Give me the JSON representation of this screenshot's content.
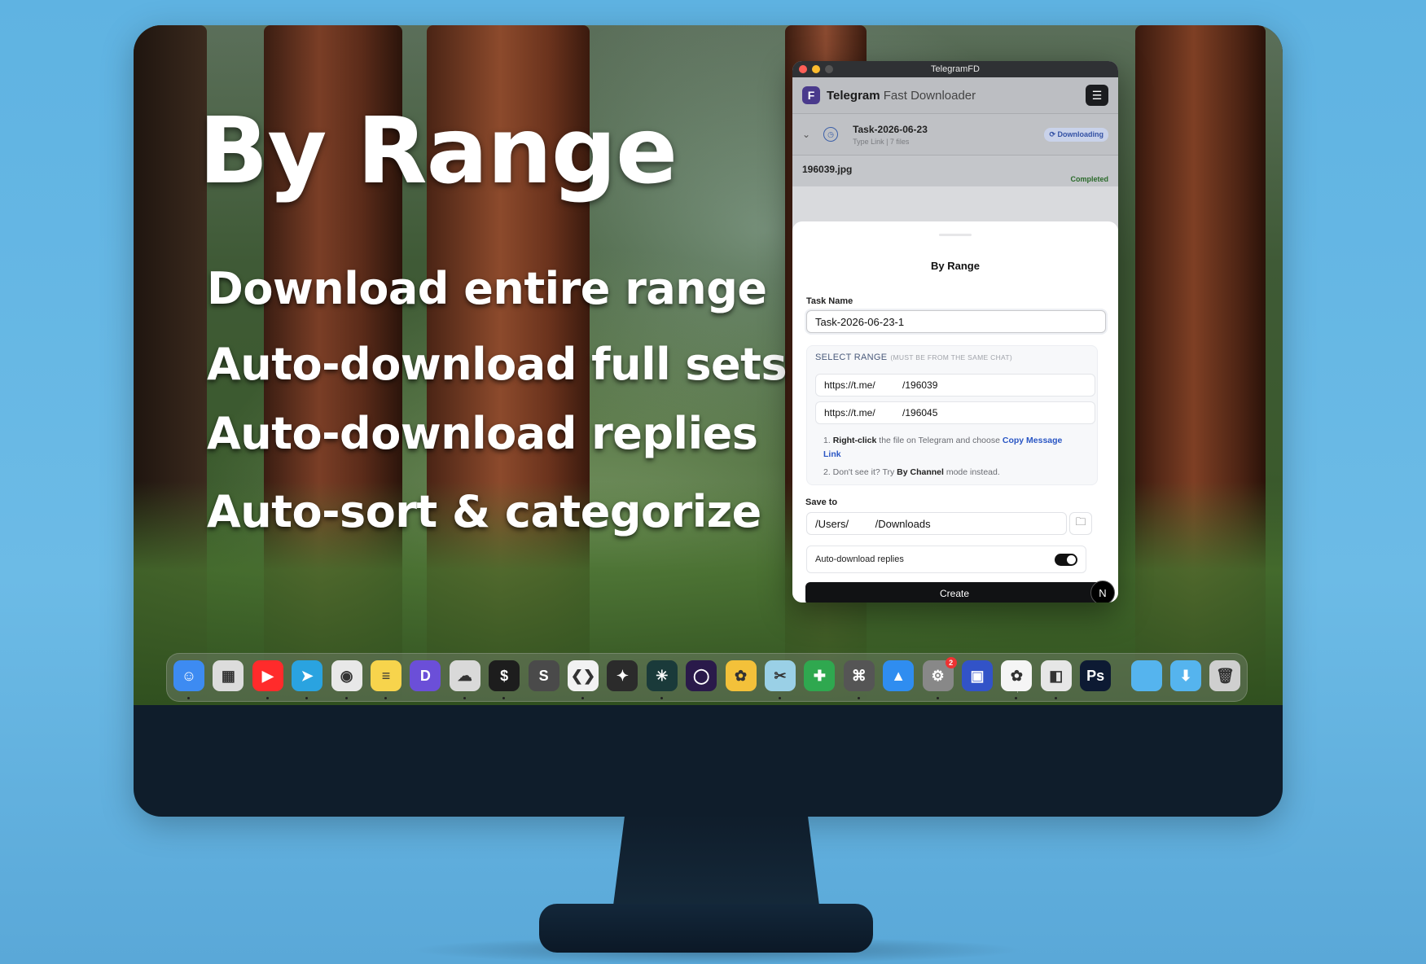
{
  "hero": {
    "headline": "By Range",
    "features": [
      "Download entire range",
      "Auto-download full sets",
      "Auto-download replies",
      "Auto-sort & categorize"
    ]
  },
  "window": {
    "title": "TelegramFD",
    "app_name_bold": "Telegram",
    "app_name_rest": " Fast Downloader",
    "logo_letter": "F",
    "menu_icon": "menu-icon"
  },
  "task": {
    "name": "Task-2026-06-23",
    "meta": "Type   Link   |   7 files",
    "status": "Downloading"
  },
  "file": {
    "name": "196039.jpg",
    "status": "Completed"
  },
  "modal": {
    "title": "By Range",
    "task_name_label": "Task Name",
    "task_name_value": "Task-2026-06-23-1",
    "range_heading": "SELECT RANGE",
    "range_note": "(MUST BE FROM THE SAME CHAT)",
    "link_start": "https://t.me/          /196039",
    "link_end": "https://t.me/          /196045",
    "hint1_prefix": "1. ",
    "hint1_bold": "Right-click",
    "hint1_text": " the file on Telegram and choose ",
    "hint1_link": "Copy Message Link",
    "hint2_prefix": "2. Don't see it? Try ",
    "hint2_bold": "By Channel",
    "hint2_text": " mode instead.",
    "save_label": "Save to",
    "save_value": "/Users/         /Downloads",
    "auto_reply_label": "Auto-download replies",
    "auto_reply_on": true,
    "create_label": "Create",
    "n_badge": "N"
  },
  "dock": {
    "apps": [
      {
        "name": "finder-icon",
        "color": "#3d8bf2",
        "glyph": "☺"
      },
      {
        "name": "launchpad-icon",
        "color": "#dcdcdc",
        "glyph": "▦"
      },
      {
        "name": "youtube-music-icon",
        "color": "#ff2b2b",
        "glyph": "▶"
      },
      {
        "name": "telegram-icon",
        "color": "#2aa3e0",
        "glyph": "➤"
      },
      {
        "name": "chrome-icon",
        "color": "#e8e8e8",
        "glyph": "◉"
      },
      {
        "name": "notes-icon",
        "color": "#f7d44c",
        "glyph": "≡"
      },
      {
        "name": "discord-like-icon",
        "color": "#6b4fd8",
        "glyph": "D"
      },
      {
        "name": "cloud-icon",
        "color": "#d9d9d9",
        "glyph": "☁"
      },
      {
        "name": "terminal-icon",
        "color": "#1d1d1d",
        "glyph": "$"
      },
      {
        "name": "sublime-icon",
        "color": "#4a4a4a",
        "glyph": "S"
      },
      {
        "name": "vscode-icon",
        "color": "#f2f2f2",
        "glyph": "❮❯"
      },
      {
        "name": "final-cut-icon",
        "color": "#2b2b2b",
        "glyph": "✦"
      },
      {
        "name": "perplexity-icon",
        "color": "#1a3a3a",
        "glyph": "✳"
      },
      {
        "name": "arc-icon",
        "color": "#2a1a4a",
        "glyph": "◯"
      },
      {
        "name": "paw-icon",
        "color": "#f3c13a",
        "glyph": "✿"
      },
      {
        "name": "scissors-icon",
        "color": "#9ad0e6",
        "glyph": "✂"
      },
      {
        "name": "xcode-icon",
        "color": "#2fa84f",
        "glyph": "✚"
      },
      {
        "name": "command-icon",
        "color": "#555",
        "glyph": "⌘"
      },
      {
        "name": "mountain-icon",
        "color": "#2f8df0",
        "glyph": "▲"
      },
      {
        "name": "system-settings-icon",
        "color": "#888",
        "glyph": "⚙",
        "badge": "2"
      },
      {
        "name": "screen-icon",
        "color": "#3253c8",
        "glyph": "▣"
      },
      {
        "name": "photos-icon",
        "color": "#f5f5f5",
        "glyph": "✿"
      },
      {
        "name": "remote-desktop-icon",
        "color": "#e6e6e6",
        "glyph": "◧"
      },
      {
        "name": "photoshop-icon",
        "color": "#0d1a33",
        "glyph": "Ps"
      },
      {
        "name": "folder-icon",
        "color": "#55b4ee",
        "glyph": ""
      },
      {
        "name": "downloads-folder-icon",
        "color": "#55b4ee",
        "glyph": "⬇"
      },
      {
        "name": "trash-icon",
        "color": "#cfcfcf",
        "glyph": "🗑"
      }
    ]
  }
}
